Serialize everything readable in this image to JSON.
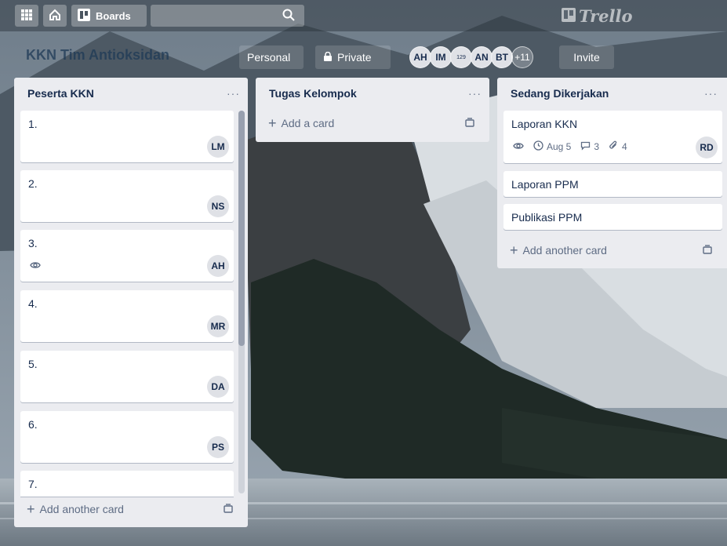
{
  "topbar": {
    "apps_icon": "grid-icon",
    "home_icon": "home-icon",
    "boards_label": "Boards",
    "search_icon": "search-icon",
    "logo_text": "Trello"
  },
  "board": {
    "title": "KKN Tim Antioksidan",
    "visibility_team": "Personal",
    "visibility": "Private",
    "members": [
      "AH",
      "IM",
      "129",
      "AN",
      "BT"
    ],
    "more_members": "+11",
    "invite_label": "Invite"
  },
  "lists": [
    {
      "title": "Peserta KKN",
      "menu": "···",
      "cards": [
        {
          "title": "1.",
          "member": "LM"
        },
        {
          "title": "2.",
          "member": "NS"
        },
        {
          "title": "3.",
          "member": "AH",
          "watch": true
        },
        {
          "title": "4.",
          "member": "MR"
        },
        {
          "title": "5.",
          "member": "DA"
        },
        {
          "title": "6.",
          "member": "PS"
        },
        {
          "title": "7."
        }
      ],
      "add_label": "Add another card"
    },
    {
      "title": "Tugas Kelompok",
      "menu": "···",
      "add_label": "Add a card"
    },
    {
      "title": "Sedang Dikerjakan",
      "menu": "···",
      "cards": [
        {
          "title": "Laporan KKN",
          "member": "RD",
          "due": "Aug 5",
          "comments": "3",
          "attachments": "4"
        },
        {
          "title": "Laporan PPM"
        },
        {
          "title": "Publikasi PPM"
        }
      ],
      "add_label": "Add another card"
    }
  ],
  "colors": {
    "list_bg": "#ebecf0",
    "card_bg": "#ffffff",
    "text": "#172b4d",
    "muted": "#5e6c84"
  }
}
